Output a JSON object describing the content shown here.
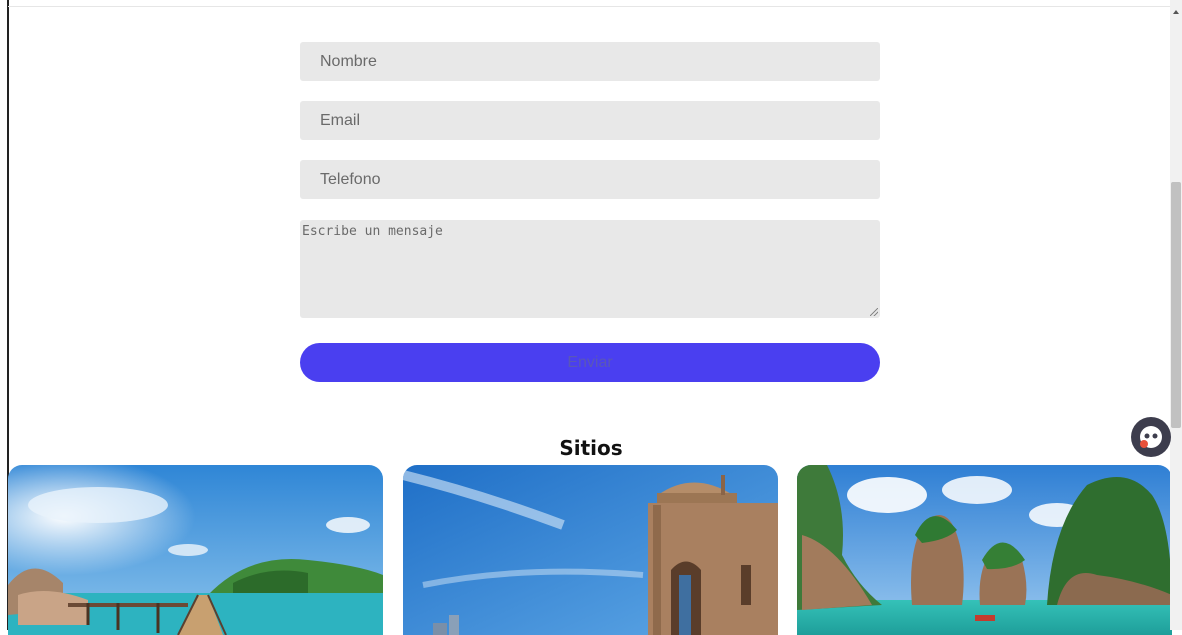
{
  "form": {
    "name_placeholder": "Nombre",
    "email_placeholder": "Email",
    "phone_placeholder": "Telefono",
    "message_placeholder": "Escribe un mensaje",
    "submit_label": "Enviar"
  },
  "sites": {
    "title": "Sitios",
    "cards": [
      {
        "icon": "beach-pier-image"
      },
      {
        "icon": "fortress-tower-image"
      },
      {
        "icon": "limestone-islands-image"
      }
    ]
  },
  "colors": {
    "button": "#4a3ff0",
    "field_bg": "#e8e8e8"
  }
}
